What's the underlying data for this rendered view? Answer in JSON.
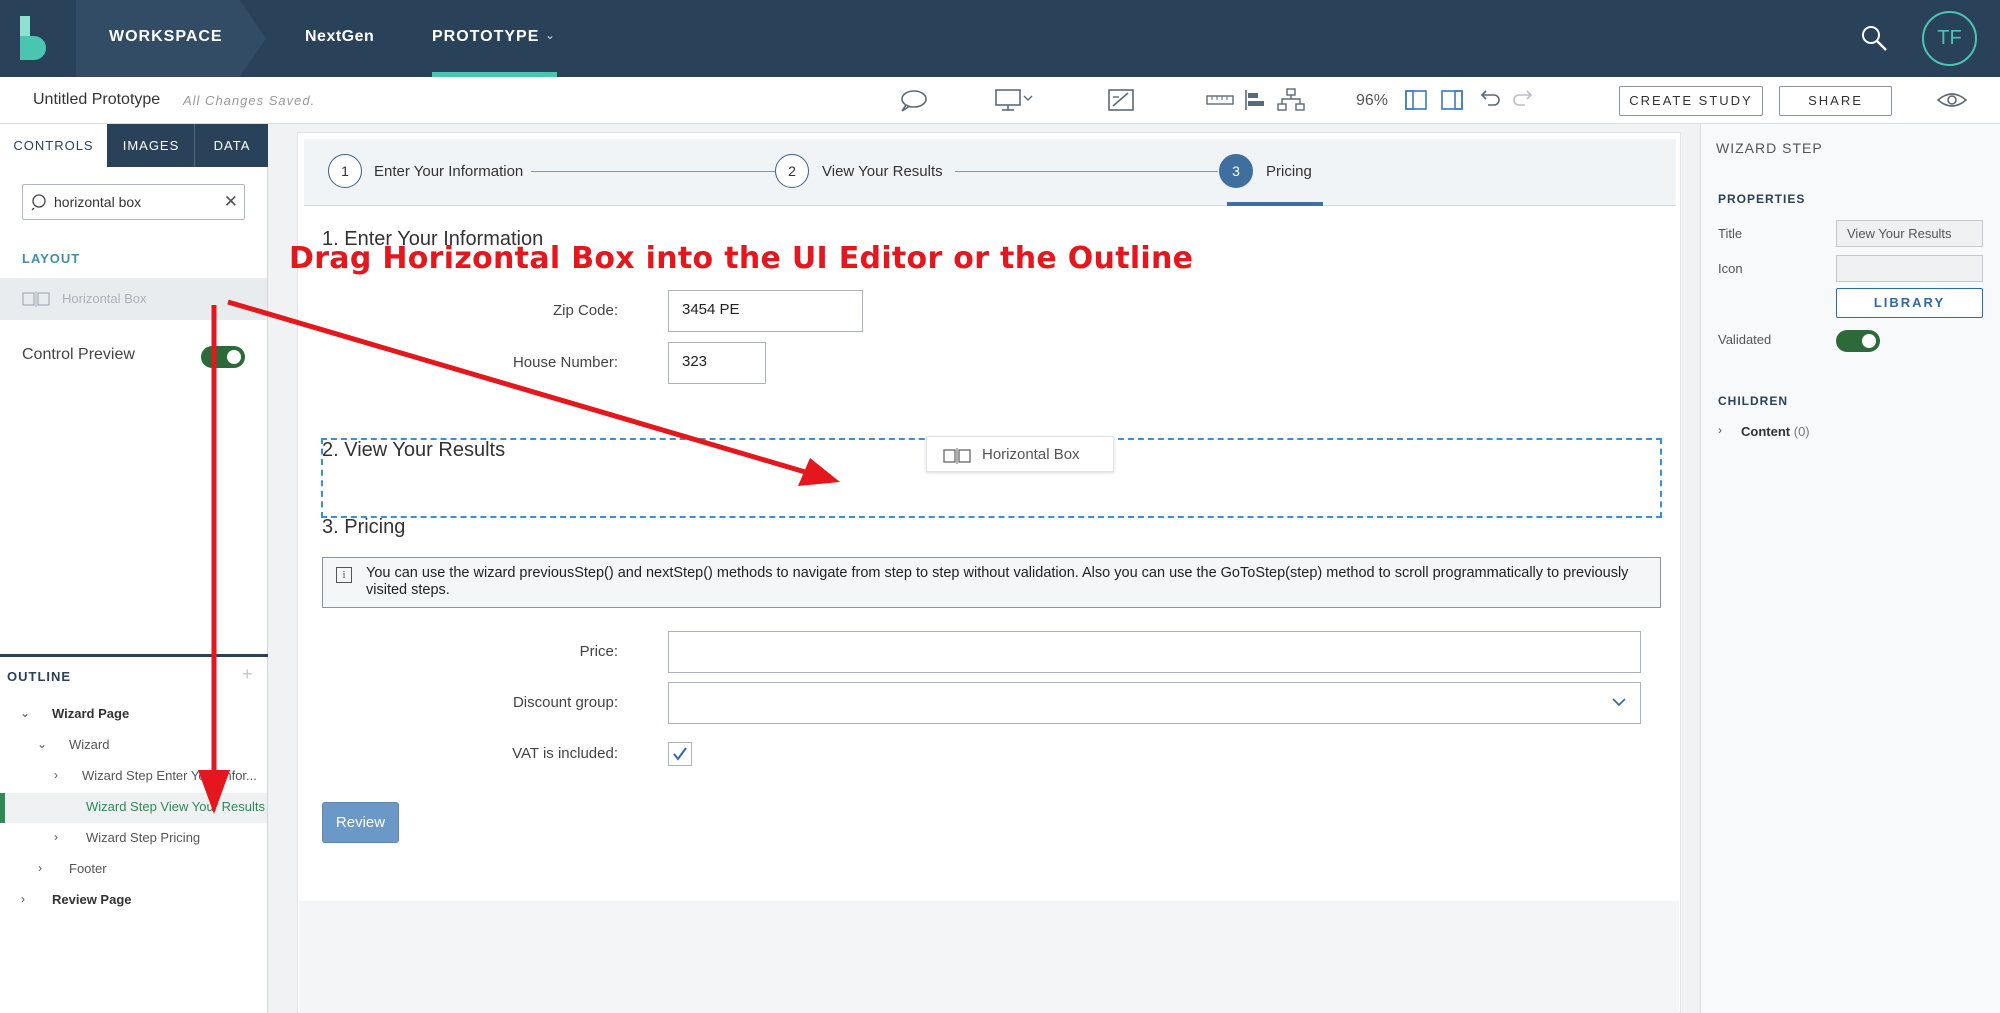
{
  "topbar": {
    "workspace": "WORKSPACE",
    "nextgen": "NextGen",
    "prototype": "PROTOTYPE",
    "avatar_initials": "TF",
    "colors": {
      "nav_bg": "#2a4259",
      "accent": "#4bc4b0"
    }
  },
  "toolbar": {
    "project_title": "Untitled Prototype",
    "save_status": "All Changes Saved.",
    "zoom": "96%",
    "create_study": "CREATE STUDY",
    "share": "SHARE",
    "icons": [
      "comment-icon",
      "desktop-icon",
      "edit-board-icon",
      "ruler-icon",
      "align-icon",
      "hierarchy-icon",
      "panel-left-icon",
      "panel-right-icon",
      "undo-icon",
      "redo-icon",
      "eye-icon"
    ]
  },
  "left_panel": {
    "tabs": [
      "CONTROLS",
      "IMAGES",
      "DATA"
    ],
    "search_value": "horizontal box",
    "layout_section": "LAYOUT",
    "layout_item": "Horizontal Box",
    "control_preview": "Control Preview",
    "outline": {
      "header": "OUTLINE",
      "items": [
        "Wizard Page",
        "Wizard",
        "Wizard Step Enter Your Infor...",
        "Wizard Step View Your Results",
        "Wizard Step Pricing",
        "Footer",
        "Review Page"
      ]
    }
  },
  "canvas": {
    "steps": [
      {
        "num": "1",
        "label": "Enter Your Information"
      },
      {
        "num": "2",
        "label": "View Your Results"
      },
      {
        "num": "3",
        "label": "Pricing"
      }
    ],
    "section1": "1. Enter Your Information",
    "zip_label": "Zip Code:",
    "zip_value": "3454 PE",
    "house_label": "House Number:",
    "house_value": "323",
    "section2": "2. View Your Results",
    "drag_chip": "Horizontal Box",
    "section3": "3. Pricing",
    "info_text": "You can use the wizard previousStep() and nextStep() methods to navigate from step to step without validation. Also you can use the GoToStep(step) method to scroll programmatically to previously visited steps.",
    "price_label": "Price:",
    "discount_label": "Discount group:",
    "vat_label": "VAT is included:",
    "vat_checked": true,
    "review_button": "Review"
  },
  "annotation": "Drag Horizontal Box into the UI Editor or the Outline",
  "right_panel": {
    "header": "WIZARD STEP",
    "properties": "PROPERTIES",
    "title_label": "Title",
    "title_value": "View Your Results",
    "icon_label": "Icon",
    "library": "LIBRARY",
    "validated_label": "Validated",
    "children": "CHILDREN",
    "child_item": "Content",
    "child_count": "(0)"
  }
}
